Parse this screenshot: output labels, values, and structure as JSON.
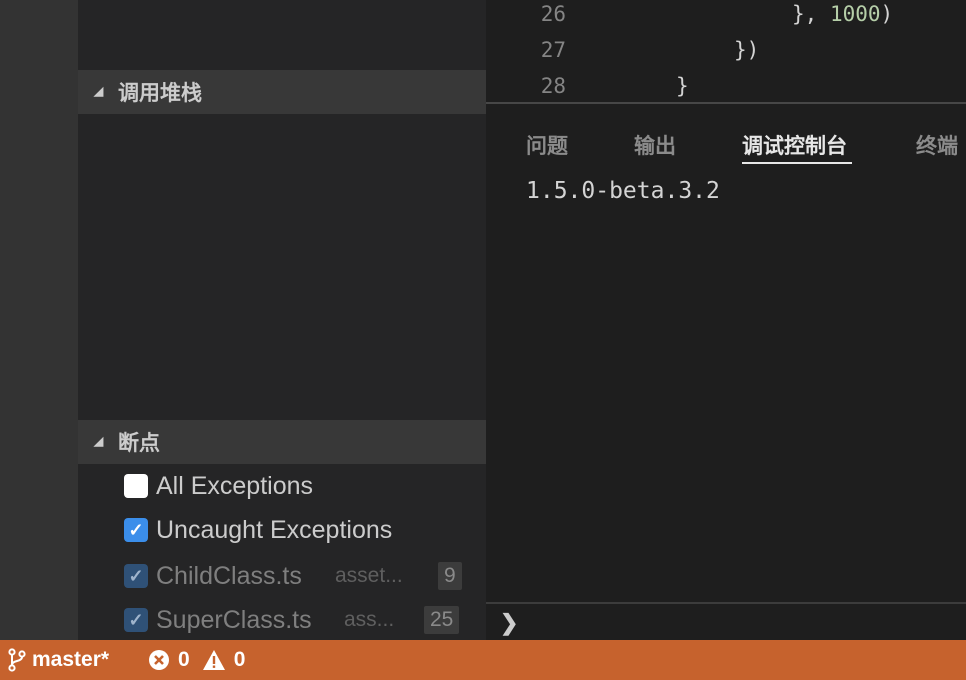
{
  "sidebar": {
    "callstack_title": "调用堆栈",
    "breakpoints_title": "断点",
    "breakpoints": [
      {
        "label": "All Exceptions",
        "checked": false
      },
      {
        "label": "Uncaught Exceptions",
        "checked": true
      },
      {
        "label": "ChildClass.ts",
        "path": "asset...",
        "line": "9",
        "checked": true
      },
      {
        "label": "SuperClass.ts",
        "path": "ass...",
        "line": "25",
        "checked": true
      }
    ]
  },
  "editor": {
    "lines": [
      {
        "num": "26",
        "pre": "}, ",
        "value": "1000",
        "post": ")"
      },
      {
        "num": "27",
        "text": "})"
      },
      {
        "num": "28",
        "text": "}"
      }
    ]
  },
  "panel": {
    "tabs": [
      "问题",
      "输出",
      "调试控制台",
      "终端"
    ],
    "active_tab": "调试控制台",
    "console_output": "1.5.0-beta.3.2",
    "prompt": "❯"
  },
  "statusbar": {
    "branch": "master*",
    "errors": "0",
    "warnings": "0",
    "color": "#c6622d"
  },
  "icons": {
    "branch": "git-branch-icon",
    "error": "error-icon",
    "warning": "warning-icon",
    "expand": "triangle-down-icon",
    "check": "checkmark-icon"
  }
}
